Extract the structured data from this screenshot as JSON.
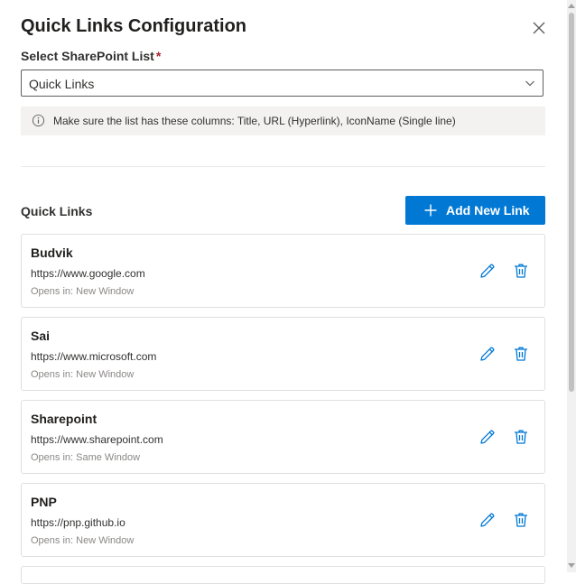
{
  "panel": {
    "title": "Quick Links Configuration",
    "close_icon": "close-icon"
  },
  "list_select": {
    "label": "Select SharePoint List",
    "required_mark": "*",
    "value": "Quick Links"
  },
  "info_bar": {
    "icon": "info-icon",
    "message": "Make sure the list has these columns: Title, URL (Hyperlink), IconName (Single line)"
  },
  "links_section": {
    "label": "Quick Links",
    "add_button_label": "Add New Link",
    "items": [
      {
        "title": "Budvik",
        "url": "https://www.google.com",
        "opens_in": "Opens in: New Window"
      },
      {
        "title": "Sai",
        "url": "https://www.microsoft.com",
        "opens_in": "Opens in: New Window"
      },
      {
        "title": "Sharepoint",
        "url": "https://www.sharepoint.com",
        "opens_in": "Opens in: Same Window"
      },
      {
        "title": "PNP",
        "url": "https://pnp.github.io",
        "opens_in": "Opens in: New Window"
      }
    ]
  },
  "colors": {
    "accent": "#0078d4",
    "required": "#a4262c",
    "info_bg": "#f3f2f1"
  }
}
